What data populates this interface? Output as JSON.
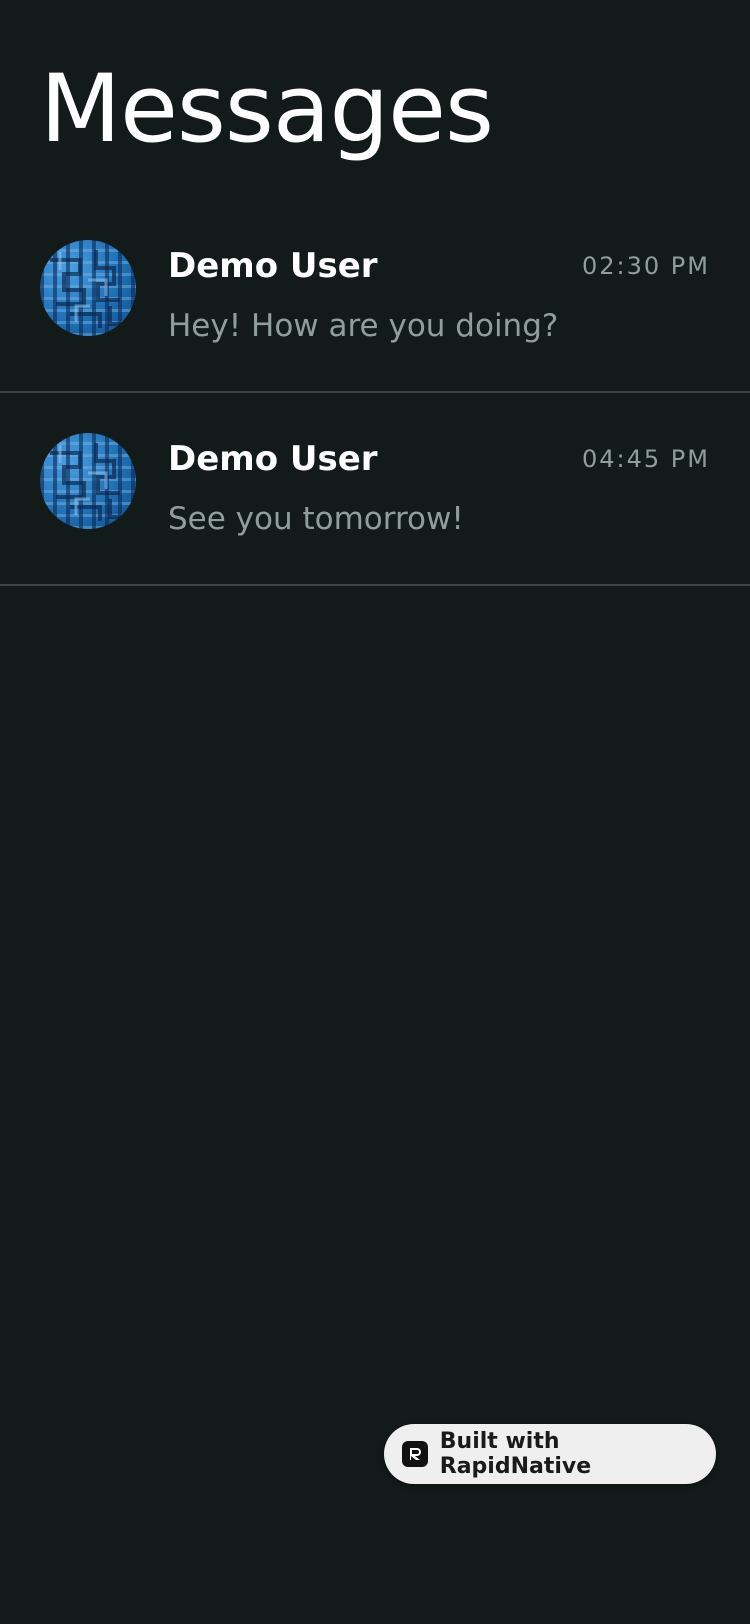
{
  "header": {
    "title": "Messages"
  },
  "messages": [
    {
      "sender": "Demo User",
      "time": "02:30 PM",
      "preview": "Hey! How are you doing?",
      "avatar_icon": "avatar-icon"
    },
    {
      "sender": "Demo User",
      "time": "04:45 PM",
      "preview": "See you tomorrow!",
      "avatar_icon": "avatar-icon"
    }
  ],
  "badge": {
    "label": "Built with RapidNative",
    "icon": "rapidnative-logo-icon"
  },
  "colors": {
    "background": "#121a1a",
    "divider": "#3a4444",
    "muted_text": "#8f9e9c",
    "primary_text": "#ffffff",
    "badge_background": "#efefef"
  }
}
